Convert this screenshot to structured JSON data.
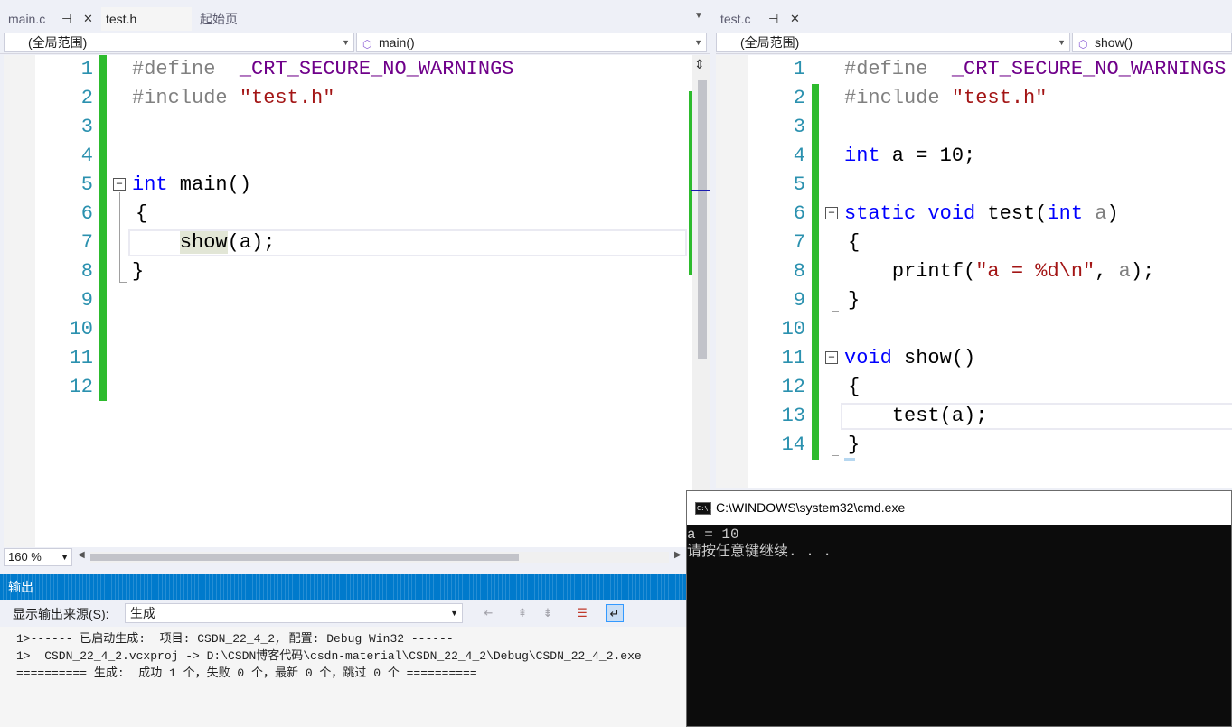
{
  "left_editor": {
    "tabs": [
      {
        "label": "main.c",
        "pin": "⊣",
        "close": "✕"
      },
      {
        "label": "test.h"
      },
      {
        "label": "起始页"
      }
    ],
    "scope": "(全局范围)",
    "member": "main()",
    "zoom": "160 %",
    "lines": [
      {
        "n": "1"
      },
      {
        "n": "2"
      },
      {
        "n": "3"
      },
      {
        "n": "4"
      },
      {
        "n": "5"
      },
      {
        "n": "6"
      },
      {
        "n": "7"
      },
      {
        "n": "8"
      },
      {
        "n": "9"
      },
      {
        "n": "10"
      },
      {
        "n": "11"
      },
      {
        "n": "12"
      }
    ],
    "code": {
      "l1_pp": "#define",
      "l1_mac": "  _CRT_SECURE_NO_WARNINGS",
      "l2_pp": "#include",
      "l2_str": "\"test.h\"",
      "l5_kw": "int",
      "l5_rest": " main()",
      "l6": "{",
      "l7_fn": "show",
      "l7_rest": "(a);",
      "l8": "}"
    }
  },
  "right_editor": {
    "tabs": [
      {
        "label": "test.c",
        "pin": "⊣",
        "close": "✕"
      }
    ],
    "scope": "(全局范围)",
    "member": "show()",
    "lines": [
      {
        "n": "1"
      },
      {
        "n": "2"
      },
      {
        "n": "3"
      },
      {
        "n": "4"
      },
      {
        "n": "5"
      },
      {
        "n": "6"
      },
      {
        "n": "7"
      },
      {
        "n": "8"
      },
      {
        "n": "9"
      },
      {
        "n": "10"
      },
      {
        "n": "11"
      },
      {
        "n": "12"
      },
      {
        "n": "13"
      },
      {
        "n": "14"
      }
    ],
    "code": {
      "l1_pp": "#define",
      "l1_mac": "  _CRT_SECURE_NO_WARNINGS",
      "l2_pp": "#include",
      "l2_str": "\"test.h\"",
      "l4_kw": "int",
      "l4_rest": " a = 10;",
      "l6_kw1": "static",
      "l6_kw2": "void",
      "l6_fn": " test(",
      "l6_kw3": "int",
      "l6_par": " a",
      "l6_close": ")",
      "l7": "{",
      "l8_fn": "printf(",
      "l8_str": "\"a = %d\\n\"",
      "l8_mid": ", ",
      "l8_par": "a",
      "l8_end": ");",
      "l9": "}",
      "l11_kw": "void",
      "l11_rest": " show()",
      "l12": "{",
      "l13_fn": "test(a);",
      "l14": "}"
    }
  },
  "output": {
    "title": "输出",
    "source_label": "显示输出来源(S):",
    "source_value": "生成",
    "lines": [
      "1>------ 已启动生成:  项目: CSDN_22_4_2, 配置: Debug Win32 ------",
      "1>  CSDN_22_4_2.vcxproj -> D:\\CSDN博客代码\\csdn-material\\CSDN_22_4_2\\Debug\\CSDN_22_4_2.exe",
      "========== 生成:  成功 1 个，失败 0 个，最新 0 个，跳过 0 个 =========="
    ]
  },
  "console": {
    "title": "C:\\WINDOWS\\system32\\cmd.exe",
    "icon_text": "C:\\.",
    "lines": [
      "a = 10",
      "请按任意键继续. . ."
    ]
  },
  "colors": {
    "keyword": "#0000ff",
    "preprocessor": "#808080",
    "macro": "#6f008a",
    "string": "#a31515",
    "line_number": "#2b91af",
    "change_bar": "#2dbb2d",
    "output_title": "#007acc"
  }
}
